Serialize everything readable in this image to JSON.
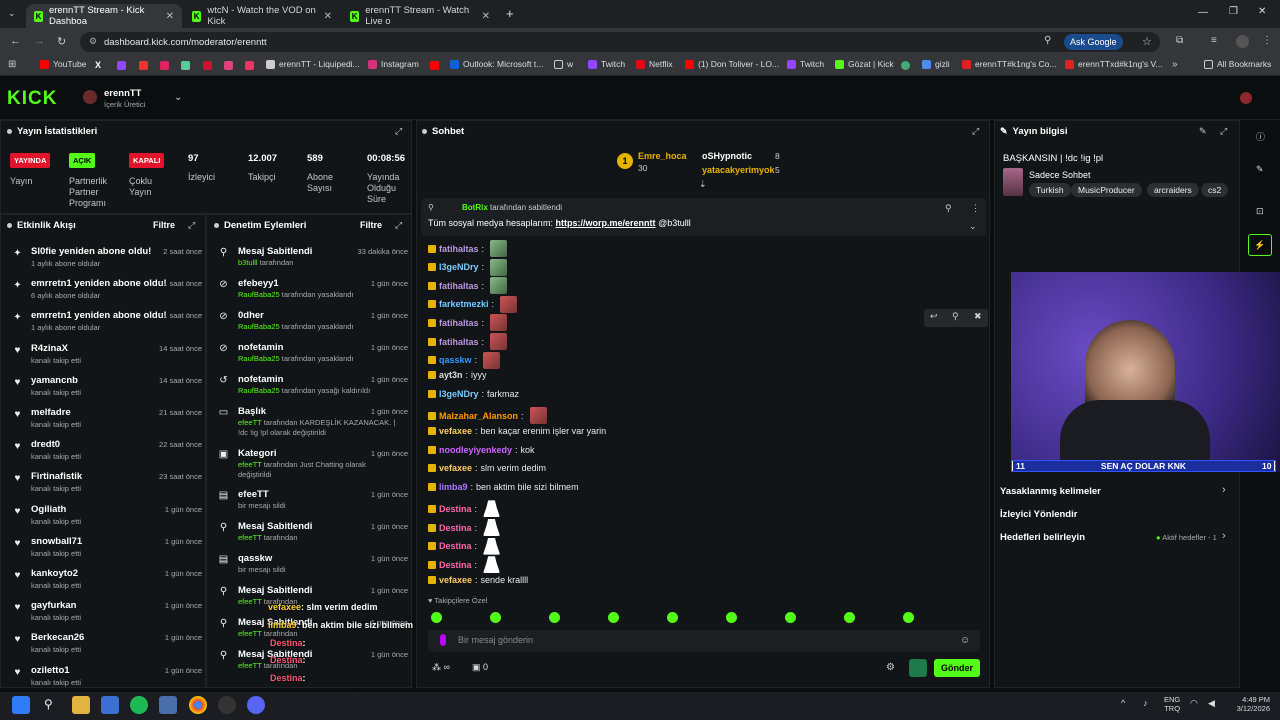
{
  "browser": {
    "tabs": [
      {
        "title": "erennTT Stream - Kick Dashboa",
        "active": true
      },
      {
        "title": "wtcN - Watch the VOD on Kick",
        "active": false
      },
      {
        "title": "erennTT Stream - Watch Live o",
        "active": false
      }
    ],
    "url": "dashboard.kick.com/moderator/erenntt",
    "ask_google": "Ask Google",
    "bookmarks": [
      "YouTube",
      "erennTT - Liquipedi...",
      "Instagram",
      "Outlook: Microsoft t...",
      "w",
      "Twitch",
      "Netflix",
      "(1) Don Toliver - LO...",
      "Twitch",
      "Gözat | Kick",
      "gizli",
      "erennTT#k1ng's Co...",
      "erennTTxd#k1ng's V...",
      "All Bookmarks"
    ]
  },
  "header": {
    "logo": "KICK",
    "user": "erennTT",
    "role": "İçerik Üretici"
  },
  "stats": {
    "title": "Yayın İstatistikleri",
    "badges": [
      {
        "text": "YAYINDA",
        "label": "Yayın",
        "color": "#e0142a"
      },
      {
        "text": "AÇIK",
        "label": "Partnerlik Partner Programı",
        "color": "#53fc18"
      },
      {
        "text": "KAPALI",
        "label": "Çoklu Yayın",
        "color": "#e0142a"
      }
    ],
    "label1": "Partnerlik",
    "label2": "Partner",
    "label3": "Programı",
    "multi1": "Çoklu",
    "multi2": "Yayın",
    "viewers": {
      "value": "97",
      "label": "İzleyici"
    },
    "followers": {
      "value": "12.007",
      "label": "Takipçi"
    },
    "subs": {
      "value": "589",
      "label1": "Abone",
      "label2": "Sayısı"
    },
    "uptime": {
      "value": "00:08:56",
      "label1": "Yayında",
      "label2": "Olduğu",
      "label3": "Süre"
    }
  },
  "activity": {
    "title": "Etkinlik Akışı",
    "filter": "Filtre",
    "items": [
      {
        "title": "Sl0fie yeniden abone oldu!",
        "sub": "1 aylık abone oldular",
        "time": "2 saat önce"
      },
      {
        "title": "emrretn1 yeniden abone oldu!",
        "sub": "6 aylık abone oldular",
        "time": "11 saat önce"
      },
      {
        "title": "emrretn1 yeniden abone oldu!",
        "sub": "1 aylık abone oldular",
        "time": "11 saat önce"
      },
      {
        "title": "R4zinaX",
        "sub": "kanalı takip etti",
        "time": "14 saat önce"
      },
      {
        "title": "yamancnb",
        "sub": "kanalı takip etti",
        "time": "14 saat önce"
      },
      {
        "title": "melfadre",
        "sub": "kanalı takip etti",
        "time": "21 saat önce"
      },
      {
        "title": "dredt0",
        "sub": "kanalı takip etti",
        "time": "22 saat önce"
      },
      {
        "title": "Firtinafistik",
        "sub": "kanalı takip etti",
        "time": "23 saat önce"
      },
      {
        "title": "Ogiliath",
        "sub": "kanalı takip etti",
        "time": "1 gün önce"
      },
      {
        "title": "snowball71",
        "sub": "kanalı takip etti",
        "time": "1 gün önce"
      },
      {
        "title": "kankoyto2",
        "sub": "kanalı takip etti",
        "time": "1 gün önce"
      },
      {
        "title": "gayfurkan",
        "sub": "kanalı takip etti",
        "time": "1 gün önce"
      },
      {
        "title": "Berkecan26",
        "sub": "kanalı takip etti",
        "time": "1 gün önce"
      },
      {
        "title": "ozil​etto1",
        "sub": "kanalı takip etti",
        "time": "1 gün önce"
      }
    ]
  },
  "mod": {
    "title": "Denetim Eylemleri",
    "filter": "Filtre",
    "items": [
      {
        "title": "Mesaj Sabitlendi",
        "who": "b3tulll",
        "rest": " tarafından",
        "time": "33 dakika önce"
      },
      {
        "title": "efebeyy1",
        "who": "RaufBaba25",
        "rest": " tarafından yasaklandı",
        "time": "1 gün önce"
      },
      {
        "title": "0dher",
        "who": "RaufBaba25",
        "rest": " tarafından yasaklandı",
        "time": "1 gün önce"
      },
      {
        "title": "nofetamin",
        "who": "RaufBaba25",
        "rest": " tarafından yasaklandı",
        "time": "1 gün önce"
      },
      {
        "title": "nofetamin",
        "who": "RaufBaba25",
        "rest": " tarafından yasağı kaldırıldı",
        "time": "1 gün önce"
      },
      {
        "title": "Başlık",
        "who": "efeeTT",
        "rest": " tarafından KARDEŞLİK KAZANACAK. | !dc !ig !pl olarak değiştirildi",
        "time": "1 gün önce"
      },
      {
        "title": "Kategori",
        "who": "efeeTT",
        "rest": " tarafından Just Chatting olarak değiştirildi",
        "time": "1 gün önce"
      },
      {
        "title": "efeeTT",
        "who": "",
        "rest": "bir mesajı sildi",
        "time": "1 gün önce"
      },
      {
        "title": "Mesaj Sabitlendi",
        "who": "efeeTT",
        "rest": " tarafından",
        "time": "1 gün önce"
      },
      {
        "title": "qasskw",
        "who": "",
        "rest": "bir mesajı sildi",
        "time": "1 gün önce"
      },
      {
        "title": "Mesaj Sabitlendi",
        "who": "efeeTT",
        "rest": " tarafından",
        "time": "1 gün önce"
      },
      {
        "title": "Mesaj Sabitlendi",
        "who": "efeeTT",
        "rest": " tarafından",
        "time": "1 gün önce"
      },
      {
        "title": "Mesaj Sabitlendi",
        "who": "efeeTT",
        "rest": " tarafından",
        "time": "1 gün önce"
      }
    ]
  },
  "chat": {
    "title": "Sohbet",
    "top": [
      {
        "rank": "1",
        "name": "Emre_hoca",
        "count": "30"
      },
      {
        "name": "oSHypnotic",
        "count": "8"
      },
      {
        "name": "yatacakyerimyok",
        "count": "5"
      }
    ],
    "pinned_by": "BotRix",
    "pinned_suffix": " tarafından sabitlendi",
    "pinned_text": "Tüm sosyal medya hesaplarım: ",
    "pinned_link": "https://worp.me/erenntt",
    "pinned_tail": " @b3tulll",
    "messages": [
      {
        "user": "fatihaltas",
        "color": "#b9d",
        "text": "",
        "emote": "g"
      },
      {
        "user": "l3geNDry",
        "color": "#7cf",
        "text": "",
        "emote": "g"
      },
      {
        "user": "fatihaltas",
        "color": "#b9d",
        "text": "",
        "emote": "g"
      },
      {
        "user": "farketmezki",
        "color": "#7cf",
        "text": "",
        "emote": "r"
      },
      {
        "user": "fatihaltas",
        "color": "#b9d",
        "text": "",
        "emote": "r"
      },
      {
        "user": "fatihaltas",
        "color": "#b9d",
        "text": "",
        "emote": "r"
      },
      {
        "user": "qasskw",
        "color": "#39f",
        "text": "",
        "emote": "r"
      },
      {
        "user": "ayt3n",
        "color": "#ddd",
        "text": "iyyy",
        "emote": ""
      },
      {
        "user": "l3geNDry",
        "color": "#7cf",
        "text": "farkmaz",
        "emote": ""
      },
      {
        "user": "Malzahar_Alanson",
        "color": "#f90",
        "text": "",
        "emote": "r"
      },
      {
        "user": "vefaxee",
        "color": "#fc6",
        "text": "ben kaçar erenim işler var yarin",
        "emote": ""
      },
      {
        "user": "noodleyiyenkedy",
        "color": "#c6f",
        "text": "kok",
        "emote": ""
      },
      {
        "user": "vefaxee",
        "color": "#fc6",
        "text": "slm verim dedim",
        "emote": ""
      },
      {
        "user": "limba9",
        "color": "#a7f",
        "text": "ben aktim bile sizi bilmem",
        "emote": ""
      },
      {
        "user": "Destina",
        "color": "#f6a",
        "text": "",
        "emote": "w"
      },
      {
        "user": "Destina",
        "color": "#f6a",
        "text": "",
        "emote": "w"
      },
      {
        "user": "Destina",
        "color": "#f6a",
        "text": "",
        "emote": "w"
      },
      {
        "user": "Destina",
        "color": "#f6a",
        "text": "",
        "emote": "w"
      },
      {
        "user": "vefaxee",
        "color": "#fc6",
        "text": "sende krallll",
        "emote": ""
      }
    ],
    "followers_only": "Takipçilere Özel",
    "placeholder": "Bir mesaj gönderin",
    "send": "Gönder",
    "infinity": "∞",
    "count": "0"
  },
  "info": {
    "title": "Yayın bilgisi",
    "stream_title": "BAŞKANSIN | !dc !ig !pl",
    "mode": "Sadece Sohbet",
    "tags": [
      "Turkish",
      "MusicProducer",
      "arcraiders",
      "cs2"
    ],
    "links": [
      "Yasaklanmış kelimeler",
      "İzleyici Yönlendir",
      "Hedefleri belirleyin"
    ],
    "goals": "Aktif hedefler - 1",
    "overlay_left": "11",
    "overlay_text": "SEN AÇ DOLAR KNK",
    "overlay_right": "10"
  },
  "overlay_chat": [
    {
      "user": "vefaxee",
      "text": ": slm verim dedim"
    },
    {
      "user": "limba9",
      "text": ": ben aktim bile sizi bilmem"
    },
    {
      "user": "Destina",
      "text": ":"
    },
    {
      "user": "Destina",
      "text": ":"
    },
    {
      "user": "Destina",
      "text": ":"
    },
    {
      "user": "vefaxee",
      "text": ": sende krallll"
    }
  ],
  "taskbar": {
    "lang1": "ENG",
    "lang2": "TRQ",
    "time": "4:49 PM",
    "date": "3/12/2026"
  }
}
